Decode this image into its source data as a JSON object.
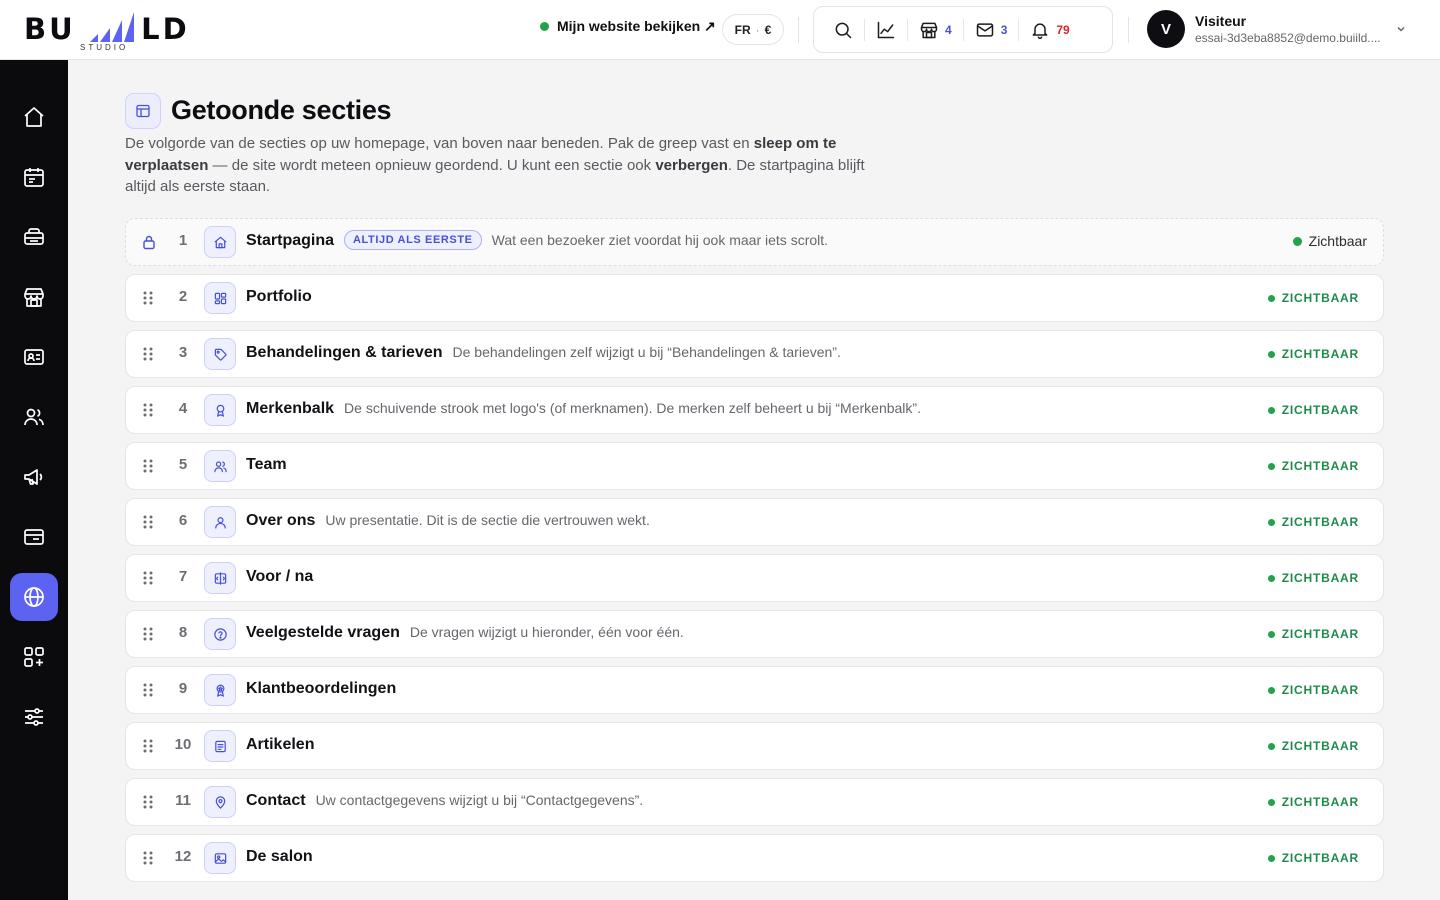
{
  "brand": {
    "logo_text": "BUILD",
    "logo_subtitle": "STUDIO",
    "accent": "#5b63f0"
  },
  "header": {
    "site_link": "Mijn website bekijken ↗",
    "locale": {
      "language": "FR",
      "separator": "·",
      "currency": "€"
    },
    "tools": [
      {
        "icon": "search-icon",
        "count": ""
      },
      {
        "icon": "chart-icon",
        "count": ""
      },
      {
        "icon": "store-icon",
        "count": "4"
      },
      {
        "icon": "mail-icon",
        "count": "3"
      },
      {
        "icon": "bell-icon",
        "count": "79"
      }
    ],
    "user": {
      "initial": "V",
      "name": "Visiteur",
      "email": "essai-3d3eba8852@demo.buiild...."
    }
  },
  "sidebar": {
    "items": [
      {
        "icon": "home-icon",
        "active": false
      },
      {
        "icon": "calendar-icon",
        "active": false
      },
      {
        "icon": "inbox-icon",
        "active": false
      },
      {
        "icon": "store-icon",
        "active": false
      },
      {
        "icon": "id-card-icon",
        "active": false
      },
      {
        "icon": "users-icon",
        "active": false
      },
      {
        "icon": "megaphone-icon",
        "active": false
      },
      {
        "icon": "card-icon",
        "active": false
      },
      {
        "icon": "globe-icon",
        "active": true
      },
      {
        "icon": "apps-plus-icon",
        "active": false
      },
      {
        "icon": "sliders-icon",
        "active": false
      }
    ]
  },
  "page": {
    "title": "Getoonde secties",
    "intro_1": "De volgorde van de secties op uw homepage, van boven naar beneden. Pak de greep vast en ",
    "intro_bold_1": "sleep om te verplaatsen",
    "intro_2": " — de site wordt meteen opnieuw geordend. U kunt een sectie ook ",
    "intro_bold_2": "verbergen",
    "intro_3": ". De startpagina blijft altijd als eerste staan."
  },
  "sections": {
    "first": {
      "number": "1",
      "name": "Startpagina",
      "badge": "ALTIJD ALS EERSTE",
      "description": "Wat een bezoeker ziet voordat hij ook maar iets scrolt.",
      "status": "Zichtbaar",
      "icon": "home-icon"
    },
    "status_label": "ZICHTBAAR",
    "rows": [
      {
        "number": "2",
        "name": "Portfolio",
        "description": "",
        "icon": "grid-icon"
      },
      {
        "number": "3",
        "name": "Behandelingen & tarieven",
        "description": "De behandelingen zelf wijzigt u bij “Behandelingen & tarieven”.",
        "icon": "tag-icon"
      },
      {
        "number": "4",
        "name": "Merkenbalk",
        "description": "De schuivende strook met logo's (of merknamen). De merken zelf beheert u bij “Merkenbalk”.",
        "icon": "award-icon"
      },
      {
        "number": "5",
        "name": "Team",
        "description": "",
        "icon": "users-icon"
      },
      {
        "number": "6",
        "name": "Over ons",
        "description": "Uw presentatie. Dit is de sectie die vertrouwen wekt.",
        "icon": "user-icon"
      },
      {
        "number": "7",
        "name": "Voor / na",
        "description": "",
        "icon": "compare-icon"
      },
      {
        "number": "8",
        "name": "Veelgestelde vragen",
        "description": "De vragen wijzigt u hieronder, één voor één.",
        "icon": "question-icon"
      },
      {
        "number": "9",
        "name": "Klantbeoordelingen",
        "description": "",
        "icon": "ribbon-icon"
      },
      {
        "number": "10",
        "name": "Artikelen",
        "description": "",
        "icon": "article-icon"
      },
      {
        "number": "11",
        "name": "Contact",
        "description": "Uw contactgegevens wijzigt u bij “Contactgegevens”.",
        "icon": "pin-icon"
      },
      {
        "number": "12",
        "name": "De salon",
        "description": "",
        "icon": "image-icon"
      }
    ]
  }
}
